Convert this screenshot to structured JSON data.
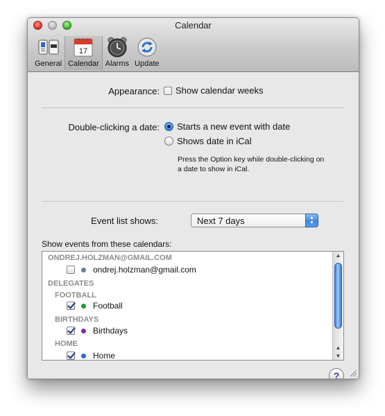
{
  "window": {
    "title": "Calendar"
  },
  "toolbar": {
    "items": [
      {
        "label": "General",
        "icon": "general-switch-icon",
        "selected": false
      },
      {
        "label": "Calendar",
        "icon": "calendar-icon",
        "selected": true,
        "icon_text": "17"
      },
      {
        "label": "Alarms",
        "icon": "alarm-clock-icon",
        "selected": false
      },
      {
        "label": "Update",
        "icon": "refresh-icon",
        "selected": false
      }
    ]
  },
  "appearance": {
    "label": "Appearance:",
    "checkbox_label": "Show calendar weeks",
    "checked": false
  },
  "double_click": {
    "label": "Double-clicking a date:",
    "options": [
      {
        "label": "Starts a new event with date",
        "selected": true
      },
      {
        "label": "Shows date in iCal",
        "selected": false
      }
    ],
    "hint_line1": "Press the Option key while double-clicking on",
    "hint_line2": "a date to show in iCal."
  },
  "event_list": {
    "label": "Event list shows:",
    "selected": "Next 7 days"
  },
  "calendars": {
    "label": "Show events from these calendars:",
    "groups": [
      {
        "name": "ONDREJ.HOLZMAN@GMAIL.COM"
      },
      {
        "name": "DELEGATES"
      },
      {
        "name": "FOOTBALL"
      },
      {
        "name": "BIRTHDAYS"
      },
      {
        "name": "HOME"
      }
    ],
    "items": [
      {
        "name": "ondrej.holzman@gmail.com",
        "checked": false,
        "color": "#6b7c96"
      },
      {
        "name": "Football",
        "checked": true,
        "color": "#1e9a2e"
      },
      {
        "name": "Birthdays",
        "checked": true,
        "color": "#7a2fb5"
      },
      {
        "name": "Home",
        "checked": true,
        "color": "#2d6ad6"
      }
    ]
  },
  "help": {
    "label": "?"
  },
  "colors": {
    "accent": "#3a7fd8"
  }
}
